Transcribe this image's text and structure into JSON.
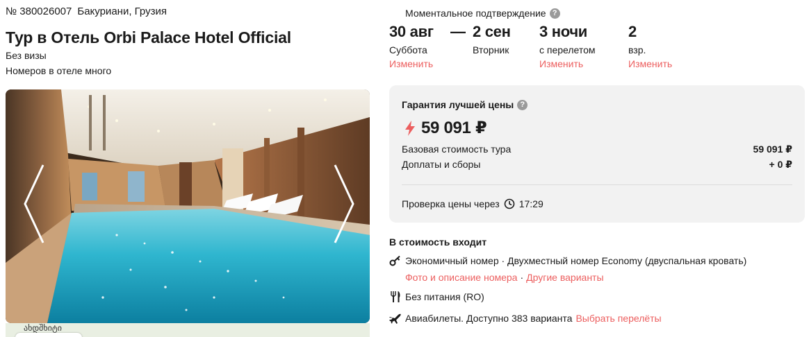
{
  "header": {
    "tour_number": "№ 380026007",
    "location": "Бакуриани, Грузия",
    "title": "Тур в Отель Orbi Palace Hotel Official",
    "visa": "Без визы",
    "rooms": "Номеров в отеле много"
  },
  "gallery": {
    "map_label": "ახდშხიტი"
  },
  "booking": {
    "instant_confirmation": "Моментальное подтверждение",
    "start_date": "30 авг",
    "start_day": "Суббота",
    "separator": "—",
    "end_date": "2 сен",
    "end_day": "Вторник",
    "nights": "3 ночи",
    "nights_note": "с перелетом",
    "adults": "2",
    "adults_note": "взр.",
    "change_label": "Изменить"
  },
  "price": {
    "guarantee": "Гарантия лучшей цены",
    "total": "59 091 ₽",
    "base_label": "Базовая стоимость тура",
    "base_value": "59 091 ₽",
    "extra_label": "Доплаты и сборы",
    "extra_value": "+ 0 ₽",
    "check_label": "Проверка цены через",
    "check_timer": "17:29",
    "accent_color": "#ec5e5e"
  },
  "includes": {
    "title": "В стоимость входит",
    "room": "Экономичный номер · Двухместный номер Economy (двуспальная кровать)",
    "room_photo_link": "Фото и описание номера",
    "room_other_link": "Другие варианты",
    "meal": "Без питания (RO)",
    "flights": "Авиабилеты. Доступно 383 варианта",
    "flights_link": "Выбрать перелёты"
  }
}
